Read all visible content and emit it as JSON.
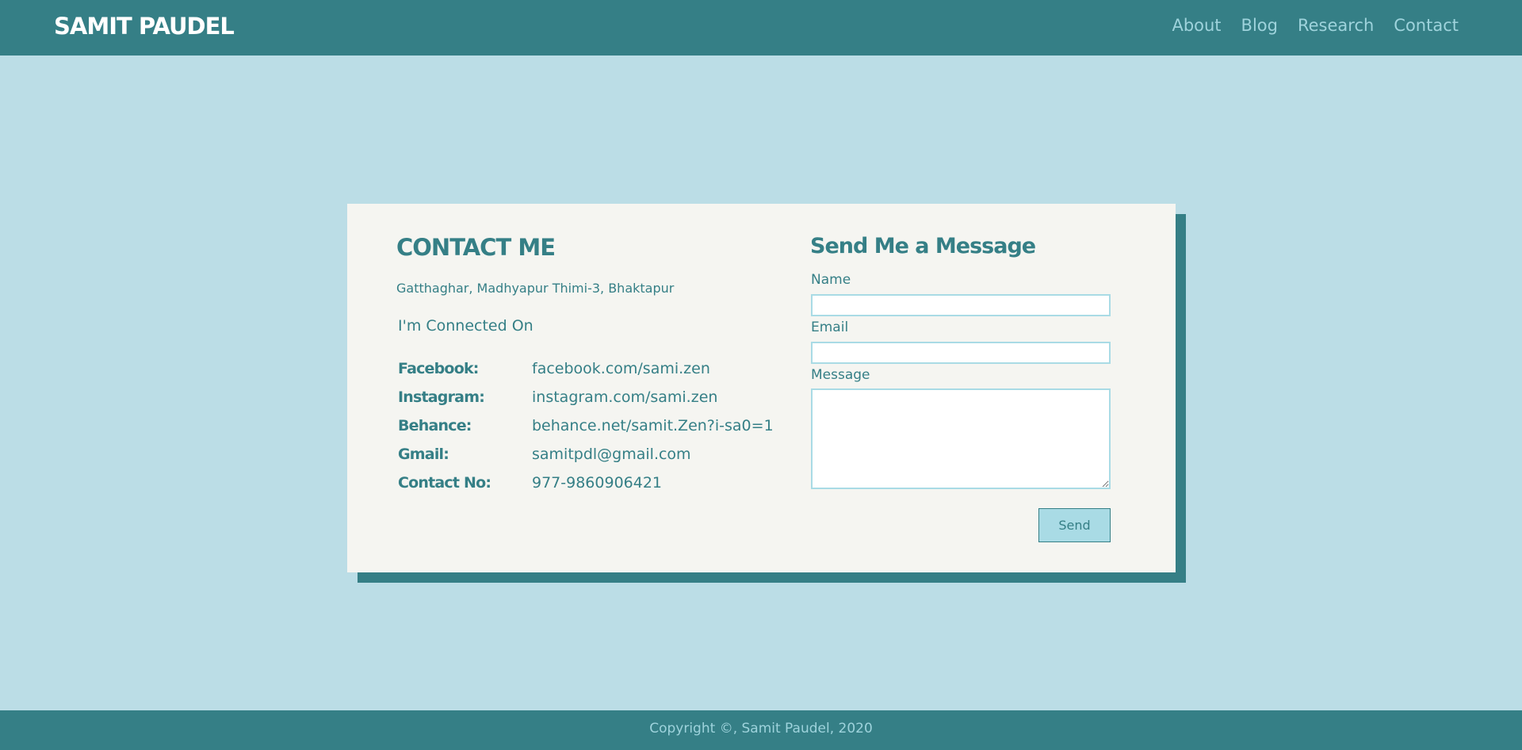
{
  "header": {
    "brand": "SAMIT PAUDEL",
    "nav": [
      "About",
      "Blog",
      "Research",
      "Contact"
    ]
  },
  "contact": {
    "title": "CONTACT ME",
    "address": "Gatthaghar, Madhyapur Thimi-3, Bhaktapur",
    "connected_heading": "I'm Connected On",
    "socials": [
      {
        "label": "Facebook:",
        "value": "facebook.com/sami.zen"
      },
      {
        "label": "Instagram:",
        "value": "instagram.com/sami.zen"
      },
      {
        "label": "Behance:",
        "value": "behance.net/samit.Zen?i-sa0=1"
      },
      {
        "label": "Gmail:",
        "value": "samitpdl@gmail.com"
      },
      {
        "label": "Contact No:",
        "value": "977-9860906421"
      }
    ]
  },
  "form": {
    "title": "Send Me a Message",
    "name_label": "Name",
    "email_label": "Email",
    "message_label": "Message",
    "name_value": "",
    "email_value": "",
    "message_value": "",
    "send_label": "Send"
  },
  "footer": {
    "copyright": "Copyright ©, Samit Paudel, 2020"
  },
  "colors": {
    "page_background": "#bbdde6",
    "bar_teal": "#357f86",
    "card_background": "#f5f5f1",
    "nav_link": "#9ed3dc",
    "input_border": "#a9dbe5"
  }
}
